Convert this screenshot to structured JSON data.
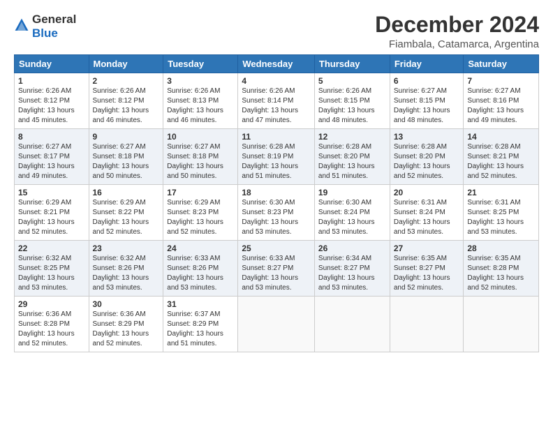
{
  "logo": {
    "general": "General",
    "blue": "Blue"
  },
  "title": "December 2024",
  "subtitle": "Fiambala, Catamarca, Argentina",
  "headers": [
    "Sunday",
    "Monday",
    "Tuesday",
    "Wednesday",
    "Thursday",
    "Friday",
    "Saturday"
  ],
  "weeks": [
    [
      {
        "day": "1",
        "info": "Sunrise: 6:26 AM\nSunset: 8:12 PM\nDaylight: 13 hours\nand 45 minutes."
      },
      {
        "day": "2",
        "info": "Sunrise: 6:26 AM\nSunset: 8:12 PM\nDaylight: 13 hours\nand 46 minutes."
      },
      {
        "day": "3",
        "info": "Sunrise: 6:26 AM\nSunset: 8:13 PM\nDaylight: 13 hours\nand 46 minutes."
      },
      {
        "day": "4",
        "info": "Sunrise: 6:26 AM\nSunset: 8:14 PM\nDaylight: 13 hours\nand 47 minutes."
      },
      {
        "day": "5",
        "info": "Sunrise: 6:26 AM\nSunset: 8:15 PM\nDaylight: 13 hours\nand 48 minutes."
      },
      {
        "day": "6",
        "info": "Sunrise: 6:27 AM\nSunset: 8:15 PM\nDaylight: 13 hours\nand 48 minutes."
      },
      {
        "day": "7",
        "info": "Sunrise: 6:27 AM\nSunset: 8:16 PM\nDaylight: 13 hours\nand 49 minutes."
      }
    ],
    [
      {
        "day": "8",
        "info": "Sunrise: 6:27 AM\nSunset: 8:17 PM\nDaylight: 13 hours\nand 49 minutes."
      },
      {
        "day": "9",
        "info": "Sunrise: 6:27 AM\nSunset: 8:18 PM\nDaylight: 13 hours\nand 50 minutes."
      },
      {
        "day": "10",
        "info": "Sunrise: 6:27 AM\nSunset: 8:18 PM\nDaylight: 13 hours\nand 50 minutes."
      },
      {
        "day": "11",
        "info": "Sunrise: 6:28 AM\nSunset: 8:19 PM\nDaylight: 13 hours\nand 51 minutes."
      },
      {
        "day": "12",
        "info": "Sunrise: 6:28 AM\nSunset: 8:20 PM\nDaylight: 13 hours\nand 51 minutes."
      },
      {
        "day": "13",
        "info": "Sunrise: 6:28 AM\nSunset: 8:20 PM\nDaylight: 13 hours\nand 52 minutes."
      },
      {
        "day": "14",
        "info": "Sunrise: 6:28 AM\nSunset: 8:21 PM\nDaylight: 13 hours\nand 52 minutes."
      }
    ],
    [
      {
        "day": "15",
        "info": "Sunrise: 6:29 AM\nSunset: 8:21 PM\nDaylight: 13 hours\nand 52 minutes."
      },
      {
        "day": "16",
        "info": "Sunrise: 6:29 AM\nSunset: 8:22 PM\nDaylight: 13 hours\nand 52 minutes."
      },
      {
        "day": "17",
        "info": "Sunrise: 6:29 AM\nSunset: 8:23 PM\nDaylight: 13 hours\nand 52 minutes."
      },
      {
        "day": "18",
        "info": "Sunrise: 6:30 AM\nSunset: 8:23 PM\nDaylight: 13 hours\nand 53 minutes."
      },
      {
        "day": "19",
        "info": "Sunrise: 6:30 AM\nSunset: 8:24 PM\nDaylight: 13 hours\nand 53 minutes."
      },
      {
        "day": "20",
        "info": "Sunrise: 6:31 AM\nSunset: 8:24 PM\nDaylight: 13 hours\nand 53 minutes."
      },
      {
        "day": "21",
        "info": "Sunrise: 6:31 AM\nSunset: 8:25 PM\nDaylight: 13 hours\nand 53 minutes."
      }
    ],
    [
      {
        "day": "22",
        "info": "Sunrise: 6:32 AM\nSunset: 8:25 PM\nDaylight: 13 hours\nand 53 minutes."
      },
      {
        "day": "23",
        "info": "Sunrise: 6:32 AM\nSunset: 8:26 PM\nDaylight: 13 hours\nand 53 minutes."
      },
      {
        "day": "24",
        "info": "Sunrise: 6:33 AM\nSunset: 8:26 PM\nDaylight: 13 hours\nand 53 minutes."
      },
      {
        "day": "25",
        "info": "Sunrise: 6:33 AM\nSunset: 8:27 PM\nDaylight: 13 hours\nand 53 minutes."
      },
      {
        "day": "26",
        "info": "Sunrise: 6:34 AM\nSunset: 8:27 PM\nDaylight: 13 hours\nand 53 minutes."
      },
      {
        "day": "27",
        "info": "Sunrise: 6:35 AM\nSunset: 8:27 PM\nDaylight: 13 hours\nand 52 minutes."
      },
      {
        "day": "28",
        "info": "Sunrise: 6:35 AM\nSunset: 8:28 PM\nDaylight: 13 hours\nand 52 minutes."
      }
    ],
    [
      {
        "day": "29",
        "info": "Sunrise: 6:36 AM\nSunset: 8:28 PM\nDaylight: 13 hours\nand 52 minutes."
      },
      {
        "day": "30",
        "info": "Sunrise: 6:36 AM\nSunset: 8:29 PM\nDaylight: 13 hours\nand 52 minutes."
      },
      {
        "day": "31",
        "info": "Sunrise: 6:37 AM\nSunset: 8:29 PM\nDaylight: 13 hours\nand 51 minutes."
      },
      {
        "day": "",
        "info": ""
      },
      {
        "day": "",
        "info": ""
      },
      {
        "day": "",
        "info": ""
      },
      {
        "day": "",
        "info": ""
      }
    ]
  ]
}
